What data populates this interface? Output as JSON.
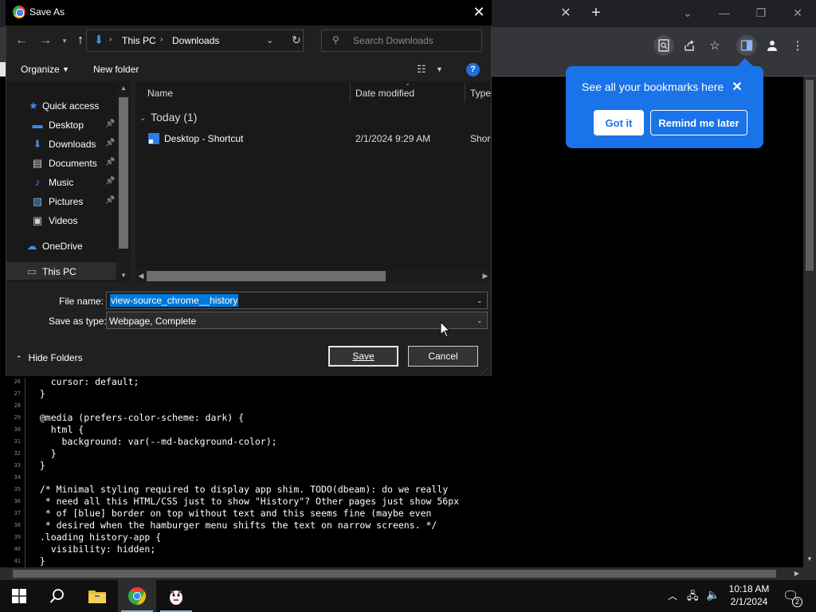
{
  "dialog": {
    "title": "Save As",
    "address": {
      "segments": [
        "This PC",
        "Downloads"
      ]
    },
    "search_placeholder": "Search Downloads",
    "toolbar": {
      "organize": "Organize",
      "new_folder": "New folder"
    },
    "nav_items": [
      {
        "label": "Quick access",
        "icon": "star-icon",
        "pinned": false
      },
      {
        "label": "Desktop",
        "icon": "desktop-icon",
        "pinned": true
      },
      {
        "label": "Downloads",
        "icon": "download-icon",
        "pinned": true
      },
      {
        "label": "Documents",
        "icon": "document-icon",
        "pinned": true
      },
      {
        "label": "Music",
        "icon": "music-icon",
        "pinned": true
      },
      {
        "label": "Pictures",
        "icon": "picture-icon",
        "pinned": true
      },
      {
        "label": "Videos",
        "icon": "video-icon",
        "pinned": false
      },
      {
        "label": "OneDrive",
        "icon": "cloud-icon",
        "pinned": false
      },
      {
        "label": "This PC",
        "icon": "computer-icon",
        "pinned": false
      }
    ],
    "columns": {
      "name": "Name",
      "date": "Date modified",
      "type": "Type"
    },
    "group": {
      "label": "Today (1)"
    },
    "files": [
      {
        "name": "Desktop - Shortcut",
        "date": "2/1/2024 9:29 AM",
        "type": "Shortcut"
      }
    ],
    "file_name_label": "File name:",
    "file_name_value": "view-source_chrome__history",
    "save_type_label": "Save as type:",
    "save_type_value": "Webpage, Complete",
    "hide_folders": "Hide Folders",
    "save_label": "Save",
    "cancel_label": "Cancel"
  },
  "bubble": {
    "text": "See all your bookmarks here",
    "got_it": "Got it",
    "remind_later": "Remind me later"
  },
  "code": {
    "lines": [
      {
        "n": "26",
        "text": "    cursor: default;"
      },
      {
        "n": "27",
        "text": "  }"
      },
      {
        "n": "28",
        "text": ""
      },
      {
        "n": "29",
        "text": "  @media (prefers-color-scheme: dark) {"
      },
      {
        "n": "30",
        "text": "    html {"
      },
      {
        "n": "31",
        "text": "      background: var(--md-background-color);"
      },
      {
        "n": "32",
        "text": "    }"
      },
      {
        "n": "33",
        "text": "  }"
      },
      {
        "n": "34",
        "text": ""
      },
      {
        "n": "35",
        "text": "  /* Minimal styling required to display app shim. TODO(dbeam): do we really"
      },
      {
        "n": "36",
        "text": "   * need all this HTML/CSS just to show \"History\"? Other pages just show 56px"
      },
      {
        "n": "37",
        "text": "   * of [blue] border on top without text and this seems fine (maybe even"
      },
      {
        "n": "38",
        "text": "   * desired when the hamburger menu shifts the text on narrow screens. */"
      },
      {
        "n": "39",
        "text": "  .loading history-app {"
      },
      {
        "n": "40",
        "text": "    visibility: hidden;"
      },
      {
        "n": "41",
        "text": "  }"
      }
    ]
  },
  "taskbar": {
    "time": "10:18 AM",
    "date": "2/1/2024",
    "notification_count": "2"
  },
  "colors": {
    "accent": "#1a73e8",
    "selection": "#0078d7"
  }
}
